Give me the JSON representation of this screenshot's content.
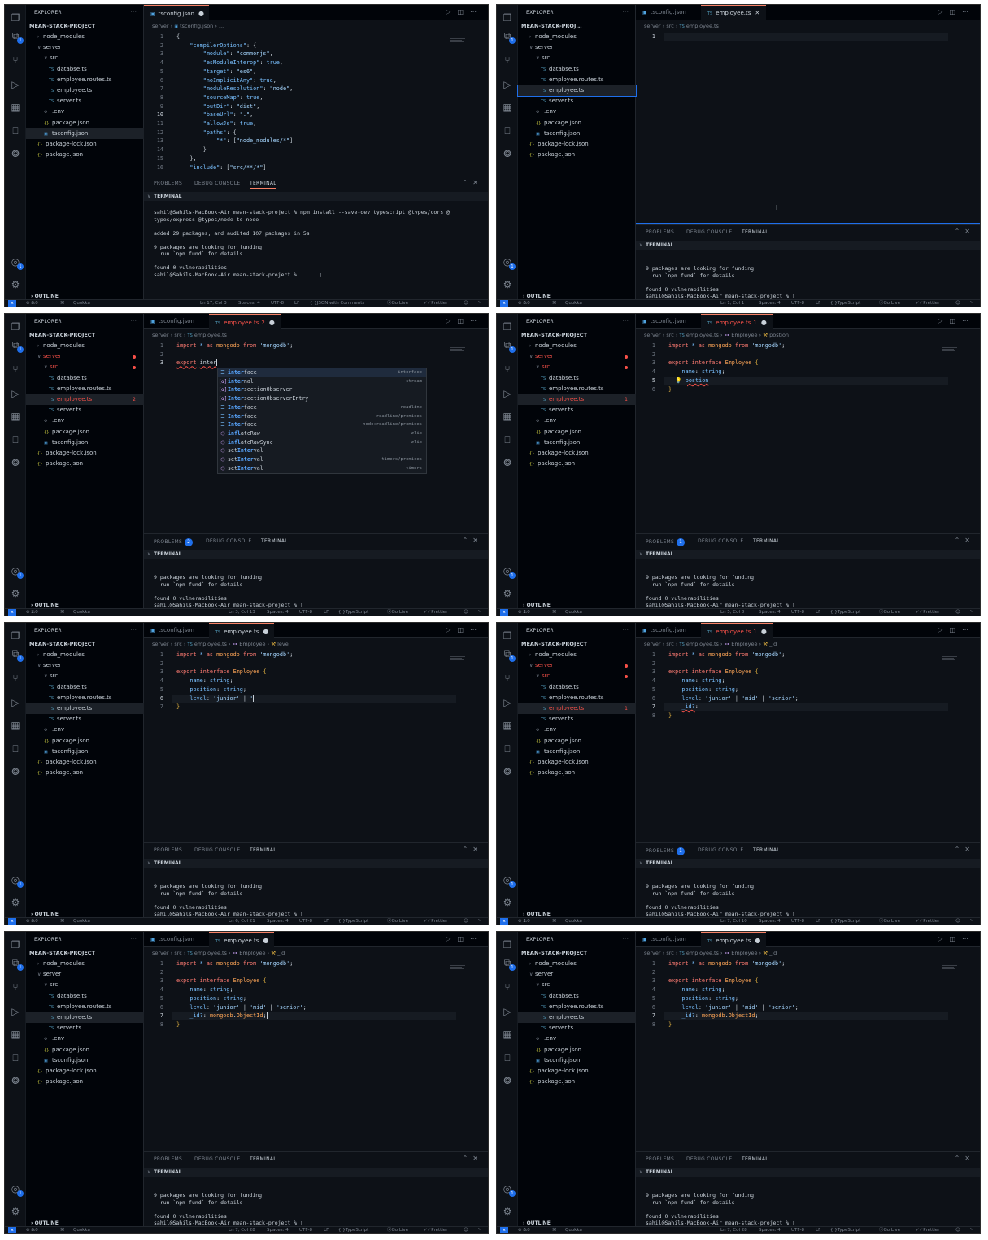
{
  "common": {
    "explorer_title": "EXPLORER",
    "more": "···",
    "project": "MEAN-STACK-PROJECT",
    "outline": "OUTLINE",
    "problems": "PROBLEMS",
    "debug_console": "DEBUG CONSOLE",
    "terminal_tab": "TERMINAL",
    "terminal_header": "TERMINAL",
    "quokka": "Quokka",
    "spaces": "Spaces: 4",
    "encoding": "UTF-8",
    "eol": "LF",
    "go_live": "Go Live",
    "prettier": "Prettier",
    "tab_tsconfig": "tsconfig.json",
    "tab_employee": "employee.ts",
    "files": {
      "node_modules": "node_modules",
      "server": "server",
      "src": "src",
      "databse": "databse.ts",
      "routes": "employee.routes.ts",
      "employee": "employee.ts",
      "serverts": "server.ts",
      "env": ".env",
      "pkg": "package.json",
      "tsconfig": "tsconfig.json",
      "pkglock": "package-lock.json",
      "pkg2": "package.json"
    },
    "term_funding1": "9 packages are looking for funding",
    "term_funding2": "  run `npm fund` for details",
    "term_vuln": "found 0 vulnerabilities",
    "term_prompt": "sahil@Sahils-MacBook-Air mean-stack-project % ",
    "crumb_server": "server",
    "crumb_src": "src",
    "crumb_tsconfig": "tsconfig.json",
    "crumb_employee": "employee.ts",
    "crumb_Employee": "Employee",
    "status_errors_zero": "0",
    "status_warn_zero": "0"
  },
  "panel1": {
    "crumb_rest": "...",
    "lines": [
      "{",
      "    \"compilerOptions\": {",
      "        \"module\": \"commonjs\",",
      "        \"esModuleInterop\": true,",
      "        \"target\": \"es6\",",
      "        \"noImplicitAny\": true,",
      "        \"moduleResolution\": \"node\",",
      "        \"sourceMap\": true,",
      "        \"outDir\": \"dist\",",
      "        \"baseUrl\": \".\",",
      "        \"allowJs\": true,",
      "        \"paths\": {",
      "            \"*\": [\"node_modules/*\"]",
      "        }",
      "    },",
      "    \"include\": [\"src/**/*\"]"
    ],
    "term": [
      "sahil@Sahils-MacBook-Air mean-stack-project % npm install --save-dev typescript @types/cors @",
      "types/express @types/node ts-node",
      "",
      "added 29 packages, and audited 107 packages in 5s",
      "",
      "9 packages are looking for funding",
      "  run `npm fund` for details",
      "",
      "found 0 vulnerabilities",
      "sahil@Sahils-MacBook-Air mean-stack-project % "
    ],
    "status_pos": "Ln 17, Col 3",
    "status_lang": "JSON with Comments"
  },
  "panel2": {
    "project_short": "MEAN-STACK-PROJ...",
    "status_pos": "Ln 1, Col 1",
    "status_lang": "TypeScript"
  },
  "panel3": {
    "status_pos": "Ln 3, Col 13",
    "status_lang": "TypeScript",
    "problems_count": "2",
    "tab_errcount": "2",
    "file_errcount": "2",
    "status_err": "2",
    "line1_import": "import",
    "line1_star": " * as ",
    "line1_mongodb": "mongodb",
    "line1_from": " from ",
    "line1_str": "'mongodb'",
    "line3_export": "export",
    "line3_word": " inter",
    "suggestions": [
      {
        "pre": "",
        "hl": "inter",
        "rest": "face",
        "detail": "interface",
        "kind": "itf"
      },
      {
        "pre": "",
        "hl": "inter",
        "rest": "nal",
        "detail": "stream",
        "kind": "mod"
      },
      {
        "pre": "",
        "hl": "Inter",
        "rest": "sectionObserver",
        "detail": "",
        "kind": "var"
      },
      {
        "pre": "",
        "hl": "Inter",
        "rest": "sectionObserverEntry",
        "detail": "",
        "kind": "var"
      },
      {
        "pre": "",
        "hl": "Inter",
        "rest": "face",
        "detail": "readline",
        "kind": "itf"
      },
      {
        "pre": "",
        "hl": "Inter",
        "rest": "face",
        "detail": "readline/promises",
        "kind": "itf"
      },
      {
        "pre": "",
        "hl": "Inter",
        "rest": "face",
        "detail": "node:readline/promises",
        "kind": "itf"
      },
      {
        "pre": "",
        "hl": "infl",
        "rest": "ateRaw",
        "detail": "zlib",
        "kind": "fn"
      },
      {
        "pre": "",
        "hl": "infl",
        "rest": "ateRawSync",
        "detail": "zlib",
        "kind": "fn"
      },
      {
        "pre": "set",
        "hl": "Inter",
        "rest": "val",
        "detail": "",
        "kind": "fn"
      },
      {
        "pre": "set",
        "hl": "Inter",
        "rest": "val",
        "detail": "timers/promises",
        "kind": "fn"
      },
      {
        "pre": "set",
        "hl": "Inter",
        "rest": "val",
        "detail": "timers",
        "kind": "fn"
      }
    ]
  },
  "panel4": {
    "crumb_prop": "postion",
    "status_pos": "Ln 5, Col 8",
    "status_lang": "TypeScript",
    "problems_count": "1",
    "tab_errcount": "1",
    "file_errcount": "1",
    "status_err": "1",
    "line4": "name: string;",
    "line5": "postion"
  },
  "panel5": {
    "crumb_prop": "level",
    "status_pos": "Ln 6, Col 21",
    "status_lang": "TypeScript",
    "line6": "level: 'junior' | '"
  },
  "panel6": {
    "crumb_prop": "_id",
    "status_pos": "Ln 7, Col 10",
    "status_lang": "TypeScript",
    "problems_count": "1",
    "tab_errcount": "1",
    "file_errcount": "1",
    "status_err": "1",
    "line7": "_id?:"
  },
  "panel7": {
    "crumb_prop": "_id",
    "status_pos": "Ln 7, Col 28",
    "status_lang": "TypeScript",
    "line7": "_id?: mongodb.ObjectId;"
  },
  "panel8": {
    "crumb_prop": "_id",
    "status_pos": "Ln 7, Col 28",
    "status_lang": "TypeScript",
    "line7": "_id?: mongodb.ObjectId;"
  },
  "code": {
    "export": "export",
    "interface": "interface",
    "Employee": "Employee",
    "name_line": "name: string;",
    "position_line": "position: string;",
    "level_line": "level: 'junior' | 'mid' | 'senior';"
  }
}
